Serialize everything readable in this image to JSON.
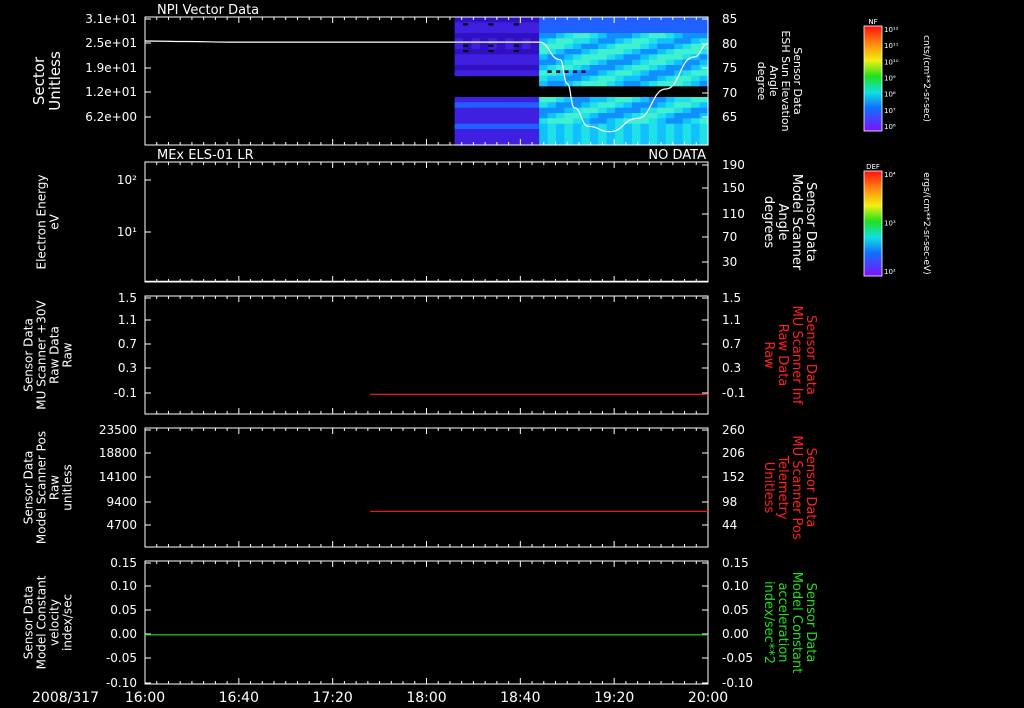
{
  "page": {
    "date_label": "2008/317"
  },
  "x_axis": {
    "ticks": [
      "16:00",
      "16:40",
      "17:20",
      "18:00",
      "18:40",
      "19:20",
      "20:00"
    ],
    "range_hours": [
      16.0,
      20.0
    ]
  },
  "colorbars": [
    {
      "title": "NF",
      "units": "cnts/(cm**2-sr-sec)",
      "ticks": [
        "10¹²",
        "10¹¹",
        "10¹⁰",
        "10⁹",
        "10⁸",
        "10⁷",
        "10⁶"
      ]
    },
    {
      "title": "DEF",
      "units": "ergs/(cm**2-sr-sec-eV)",
      "ticks": [
        "10⁴",
        "10³",
        "10²"
      ]
    }
  ],
  "panels": [
    {
      "title_left": "NPI Vector Data",
      "title_right": "",
      "left_label": [
        "Sector",
        "Unitless"
      ],
      "right_label": [
        "Sensor Data",
        "ESH Sun Elevation",
        "Angle",
        "degree"
      ],
      "left_ticks": [
        "3.1e+01",
        "2.5e+01",
        "1.9e+01",
        "1.2e+01",
        "6.2e+00"
      ],
      "right_ticks": [
        "85",
        "80",
        "75",
        "70",
        "65"
      ],
      "right_label_color": "#ffffff"
    },
    {
      "title_left": "MEx ELS-01 LR",
      "title_right": "NO DATA",
      "left_label": [
        "Electron Energy",
        "eV"
      ],
      "right_label": [
        "Sensor Data",
        "Model Scanner",
        "Angle",
        "degrees"
      ],
      "left_ticks": [
        "10²",
        "10¹"
      ],
      "right_ticks": [
        "190",
        "150",
        "110",
        "70",
        "30"
      ],
      "right_label_color": "#ffffff"
    },
    {
      "title_left": "",
      "title_right": "",
      "left_label": [
        "Sensor Data",
        "MU Scanner +30V",
        "Raw Data",
        "Raw"
      ],
      "right_label": [
        "Sensor Data",
        "MU Scanner Inf",
        "Raw Data",
        "Raw"
      ],
      "left_ticks": [
        "1.5",
        "1.1",
        "0.7",
        "0.3",
        "-0.1"
      ],
      "right_ticks": [
        "1.5",
        "1.1",
        "0.7",
        "0.3",
        "-0.1"
      ],
      "right_label_color": "#ff2020"
    },
    {
      "title_left": "",
      "title_right": "",
      "left_label": [
        "Sensor Data",
        "Model Scanner Pos",
        "Raw",
        "unitless"
      ],
      "right_label": [
        "Sensor Data",
        "MU Scanner Pos",
        "Telemetry",
        "Unitless"
      ],
      "left_ticks": [
        "23500",
        "18800",
        "14100",
        "9400",
        "4700"
      ],
      "right_ticks": [
        "260",
        "206",
        "152",
        "98",
        "44"
      ],
      "right_label_color": "#ff2020"
    },
    {
      "title_left": "",
      "title_right": "",
      "left_label": [
        "Sensor Data",
        "Model Constant",
        "velocity",
        "index/sec"
      ],
      "right_label": [
        "Sensor Data",
        "Model Constant",
        "acceleration",
        "index/sec**2"
      ],
      "left_ticks": [
        "0.15",
        "0.10",
        "0.05",
        "0.00",
        "-0.05",
        "-0.10"
      ],
      "right_ticks": [
        "0.15",
        "0.10",
        "0.05",
        "0.00",
        "-0.05",
        "-0.10"
      ],
      "right_label_color": "#20dd20"
    }
  ],
  "chart_data": [
    {
      "type": "heatmap",
      "title": "NPI Vector Data",
      "x_range_hours": [
        16.0,
        20.0
      ],
      "data_start_hour": 18.2,
      "line_series": {
        "name": "ESH Sun Elevation Angle",
        "color": "#ffffff",
        "y_range": [
          61,
          85
        ],
        "x_hours": [
          16.0,
          16.3,
          16.6,
          17.0,
          17.5,
          18.0,
          18.4,
          18.8,
          18.95,
          19.0,
          19.05,
          19.15,
          19.3,
          19.5,
          19.7,
          19.9,
          20.0
        ],
        "y": [
          80.5,
          80.4,
          80.3,
          80.3,
          80.3,
          80.3,
          80.3,
          80.3,
          77,
          72.5,
          68,
          64.5,
          63.5,
          66,
          71.5,
          77.5,
          80.0
        ]
      }
    },
    {
      "type": "line",
      "title": "MEx ELS-01 LR",
      "right_range": [
        10,
        190
      ],
      "series": [
        {
          "color": "#ffffff",
          "x_hours": [
            16.0,
            20.0
          ],
          "y": [
            11,
            11
          ]
        }
      ]
    },
    {
      "type": "line",
      "y_range": [
        -0.3,
        1.5
      ],
      "series": [
        {
          "color": "#ff2020",
          "x_hours": [
            17.6,
            20.0
          ],
          "y": [
            0.0,
            0.0
          ]
        }
      ]
    },
    {
      "type": "line",
      "y_range": [
        0,
        260
      ],
      "series": [
        {
          "color": "#ff2020",
          "x_hours": [
            17.6,
            20.0
          ],
          "y": [
            78,
            78
          ]
        }
      ]
    },
    {
      "type": "line",
      "y_range": [
        -0.1,
        0.15
      ],
      "series": [
        {
          "color": "#20dd20",
          "x_hours": [
            16.0,
            20.0
          ],
          "y": [
            0.0,
            0.0
          ]
        }
      ]
    }
  ]
}
